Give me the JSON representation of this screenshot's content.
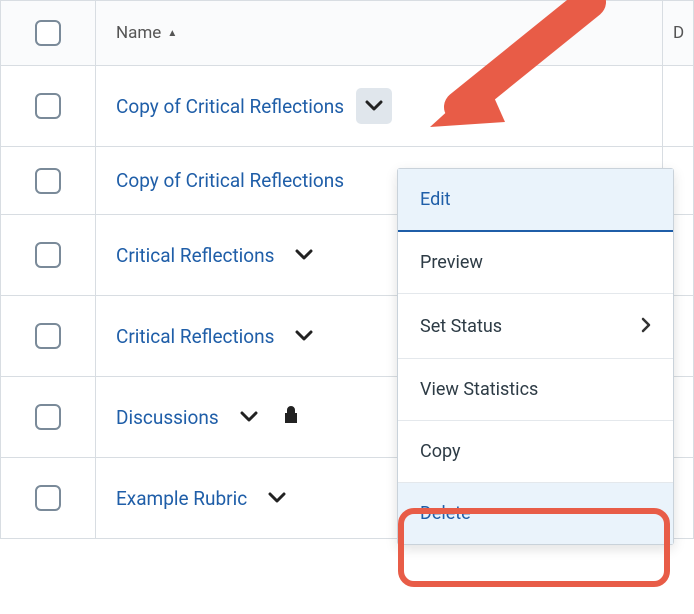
{
  "header": {
    "name_label": "Name",
    "last_col_label": "D"
  },
  "rows": [
    {
      "name": "Copy of Critical Reflections",
      "locked": false,
      "chevron_active": true
    },
    {
      "name": "Copy of Critical Reflections",
      "locked": false,
      "chevron_active": false
    },
    {
      "name": "Critical Reflections",
      "locked": false,
      "chevron_active": false
    },
    {
      "name": "Critical Reflections",
      "locked": false,
      "chevron_active": false
    },
    {
      "name": "Discussions",
      "locked": true,
      "chevron_active": false
    },
    {
      "name": "Example Rubric",
      "locked": false,
      "chevron_active": false
    }
  ],
  "menu": {
    "items": [
      {
        "label": "Edit",
        "highlighted": true,
        "has_submenu": false
      },
      {
        "label": "Preview",
        "highlighted": false,
        "has_submenu": false
      },
      {
        "label": "Set Status",
        "highlighted": false,
        "has_submenu": true
      },
      {
        "label": "View Statistics",
        "highlighted": false,
        "has_submenu": false
      },
      {
        "label": "Copy",
        "highlighted": false,
        "has_submenu": false
      },
      {
        "label": "Delete",
        "highlighted": false,
        "has_submenu": false,
        "delete": true
      }
    ]
  }
}
